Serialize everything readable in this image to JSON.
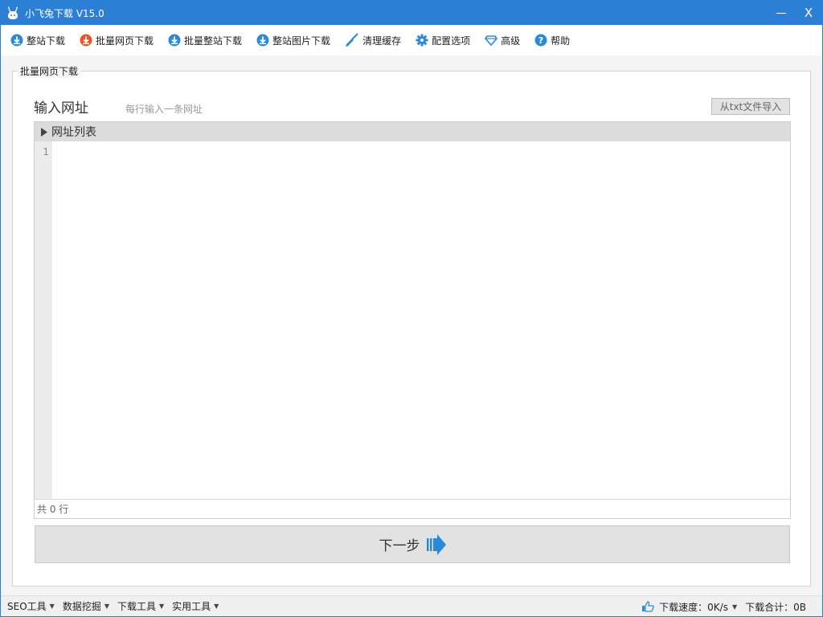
{
  "window": {
    "title": "小飞兔下载 V15.0",
    "close_label": "X"
  },
  "toolbar": {
    "items": [
      {
        "label": "整站下载",
        "icon": "cloud-download-icon",
        "color": "#2b8ad8"
      },
      {
        "label": "批量网页下载",
        "icon": "cloud-download-icon",
        "color": "#e8542b"
      },
      {
        "label": "批量整站下载",
        "icon": "cloud-download-icon",
        "color": "#2b8ad8"
      },
      {
        "label": "整站图片下载",
        "icon": "cloud-download-icon",
        "color": "#2b8ad8"
      },
      {
        "label": "清理缓存",
        "icon": "broom-icon",
        "color": "#2b8ad8"
      },
      {
        "label": "配置选项",
        "icon": "gear-icon",
        "color": "#2b8ad8"
      },
      {
        "label": "高级",
        "icon": "diamond-icon",
        "color": "#2b8ad8"
      },
      {
        "label": "帮助",
        "icon": "help-icon",
        "color": "#2b8ad8"
      }
    ]
  },
  "panel": {
    "group_title": "批量网页下载",
    "input_title": "输入网址",
    "input_hint": "每行输入一条网址",
    "import_button": "从txt文件导入",
    "list_header": "网址列表",
    "line_number": "1",
    "line_count": "共 0 行",
    "next_button": "下一步"
  },
  "statusbar": {
    "menus": [
      "SEO工具",
      "数据挖掘",
      "下载工具",
      "实用工具"
    ],
    "speed_label": "下载速度：0K/s",
    "total_label": "下载合计：0B"
  },
  "colors": {
    "accent": "#2b7fd4",
    "icon_blue": "#2b8ad8",
    "icon_orange": "#e8542b"
  }
}
